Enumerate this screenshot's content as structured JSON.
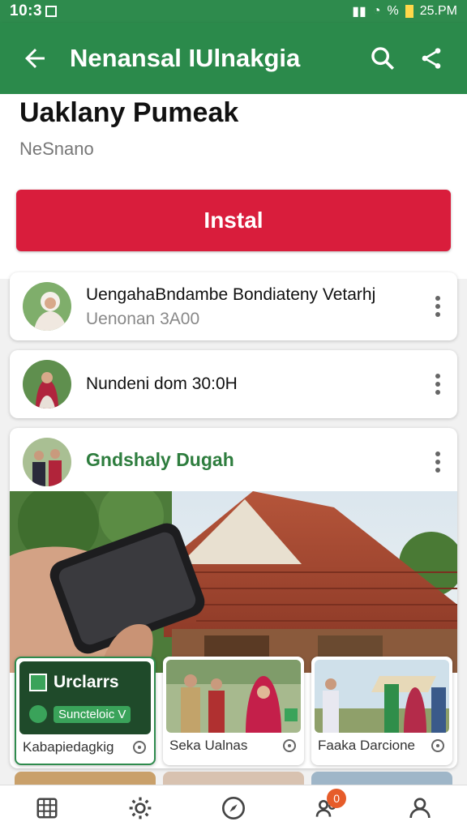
{
  "status_bar": {
    "time": "10:3",
    "battery": "%",
    "clock_right": "25.PM"
  },
  "app_bar": {
    "title": "Nenansal IUlnakgia"
  },
  "app": {
    "name": "Uaklany Pumeak",
    "developer": "NeSnano",
    "install_label": "Instal"
  },
  "reviews": [
    {
      "line1": "UengahaBndambe Bondiateny Vetarhj",
      "line2": "Uenonan 3A00"
    },
    {
      "line1": "Nundeni dom 30:0H"
    }
  ],
  "feature": {
    "name": "Gndshaly Dugah"
  },
  "thumbnails": [
    {
      "overlay_title": "Urclarrs",
      "overlay_sub": "Suncteloic V",
      "label": "Kabapiedagkig"
    },
    {
      "label": "Seka Ualnas"
    },
    {
      "label": "Faaka Darcione"
    }
  ],
  "bottom_nav": {
    "badge_count": "0"
  },
  "colors": {
    "primary": "#2b8a4b",
    "install": "#d91d3c",
    "badge": "#e65c2a"
  }
}
